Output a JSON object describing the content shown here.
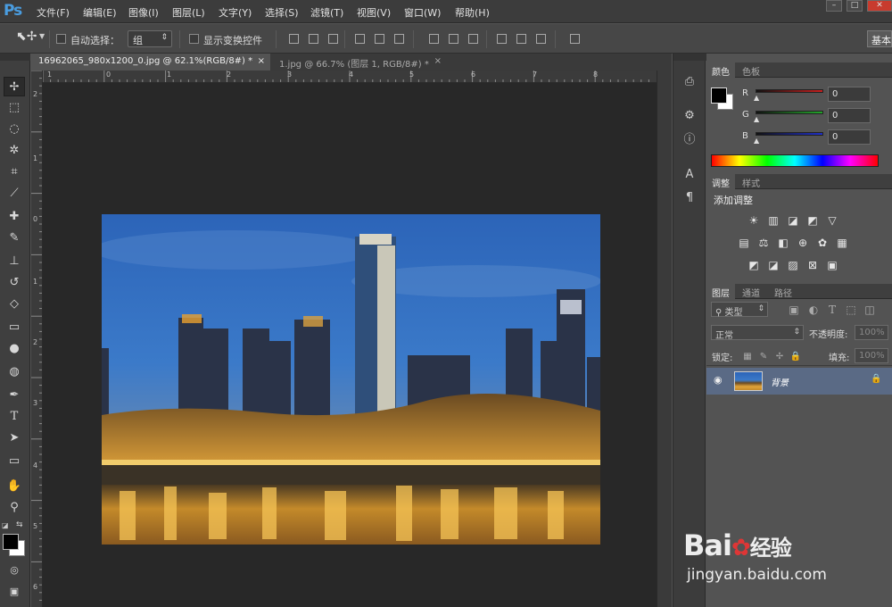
{
  "app": {
    "logo": "Ps"
  },
  "menu": [
    "文件(F)",
    "编辑(E)",
    "图像(I)",
    "图层(L)",
    "文字(Y)",
    "选择(S)",
    "滤镜(T)",
    "视图(V)",
    "窗口(W)",
    "帮助(H)"
  ],
  "window_controls": {
    "minimize": "–",
    "restore": "□",
    "close": "✕"
  },
  "options": {
    "auto_select_label": "自动选择：",
    "auto_select_value": "组",
    "transform_controls_label": "显示变换控件",
    "workspace": "基本"
  },
  "tabs": [
    {
      "label": "16962065_980x1200_0.jpg @ 62.1%(RGB/8#) *",
      "close": "×"
    },
    {
      "label": "1.jpg @ 66.7% (图层 1, RGB/8#) *",
      "close": "×"
    }
  ],
  "ruler": {
    "top": [
      "1",
      "0",
      "1",
      "2",
      "3",
      "4",
      "5",
      "6",
      "7",
      "8"
    ],
    "left": [
      "2",
      "1",
      "0",
      "1",
      "2",
      "3",
      "4",
      "5",
      "6"
    ]
  },
  "color_panel": {
    "tabs": [
      "颜色",
      "色板"
    ],
    "rows": [
      {
        "label": "R",
        "value": "0"
      },
      {
        "label": "G",
        "value": "0"
      },
      {
        "label": "B",
        "value": "0"
      }
    ],
    "track_colors": [
      "#c8201f",
      "#22a52a",
      "#2030c8"
    ]
  },
  "adjust_panel": {
    "tabs": [
      "调整",
      "样式"
    ],
    "title": "添加调整",
    "row1": [
      "☀",
      "▥",
      "◪",
      "◩",
      "▽"
    ],
    "row2": [
      "▤",
      "⚖",
      "◧",
      "⊕",
      "✿",
      "▦"
    ],
    "row3": [
      "◩",
      "◪",
      "▨",
      "⊠",
      "▣"
    ]
  },
  "layers_panel": {
    "tabs": [
      "图层",
      "通道",
      "路径"
    ],
    "filter": "类型",
    "blend_mode": "正常",
    "opacity_label": "不透明度:",
    "opacity_value": "100%",
    "lock_label": "锁定:",
    "fill_label": "填充:",
    "fill_value": "100%",
    "layer_name": "背景"
  },
  "watermark": {
    "brand": "Bai",
    "brand2": "经验",
    "url": "jingyan.baidu.com"
  }
}
